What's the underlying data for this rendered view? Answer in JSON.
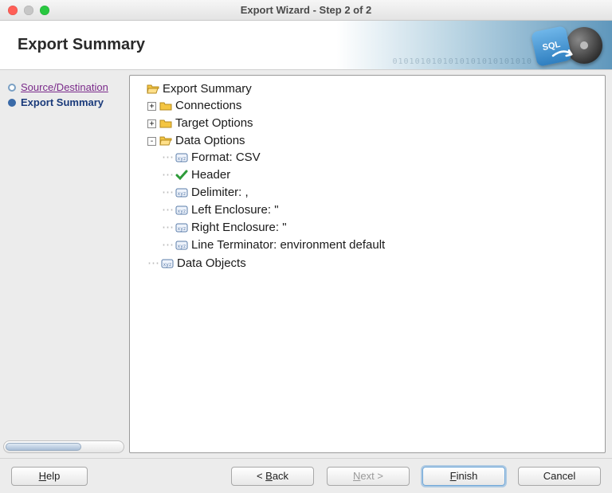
{
  "window": {
    "title": "Export Wizard - Step 2 of 2"
  },
  "banner": {
    "heading": "Export Summary",
    "badge_text": "SQL",
    "binary_decor": "0101010101010101010101010"
  },
  "sidebar": {
    "steps": [
      {
        "id": "src-dest",
        "label": "Source/Destination",
        "state": "visited"
      },
      {
        "id": "summary",
        "label": "Export Summary",
        "state": "current"
      }
    ]
  },
  "tree": {
    "root": {
      "id": "export-summary",
      "icon": "folder-open",
      "label": "Export Summary",
      "expanded": true,
      "children": [
        {
          "id": "connections",
          "icon": "folder",
          "label": "Connections",
          "toggle": "plus"
        },
        {
          "id": "target-options",
          "icon": "folder",
          "label": "Target Options",
          "toggle": "plus"
        },
        {
          "id": "data-options",
          "icon": "folder-open",
          "label": "Data Options",
          "toggle": "minus",
          "children": [
            {
              "id": "format",
              "icon": "leaf",
              "label": "Format: CSV"
            },
            {
              "id": "header",
              "icon": "check",
              "label": "Header"
            },
            {
              "id": "delimiter",
              "icon": "leaf",
              "label": "Delimiter: ,"
            },
            {
              "id": "left-enclosure",
              "icon": "leaf",
              "label": "Left Enclosure: \""
            },
            {
              "id": "right-enclosure",
              "icon": "leaf",
              "label": "Right Enclosure: \""
            },
            {
              "id": "line-terminator",
              "icon": "leaf",
              "label": "Line Terminator: environment default"
            }
          ]
        },
        {
          "id": "data-objects",
          "icon": "leaf",
          "label": "Data Objects"
        }
      ]
    }
  },
  "buttons": {
    "help": {
      "label": "Help",
      "mnemonic": "H"
    },
    "back": {
      "label": "< Back",
      "mnemonic": "B"
    },
    "next": {
      "label": "Next >",
      "mnemonic": "N",
      "disabled": true
    },
    "finish": {
      "label": "Finish",
      "mnemonic": "F",
      "default": true
    },
    "cancel": {
      "label": "Cancel"
    }
  }
}
